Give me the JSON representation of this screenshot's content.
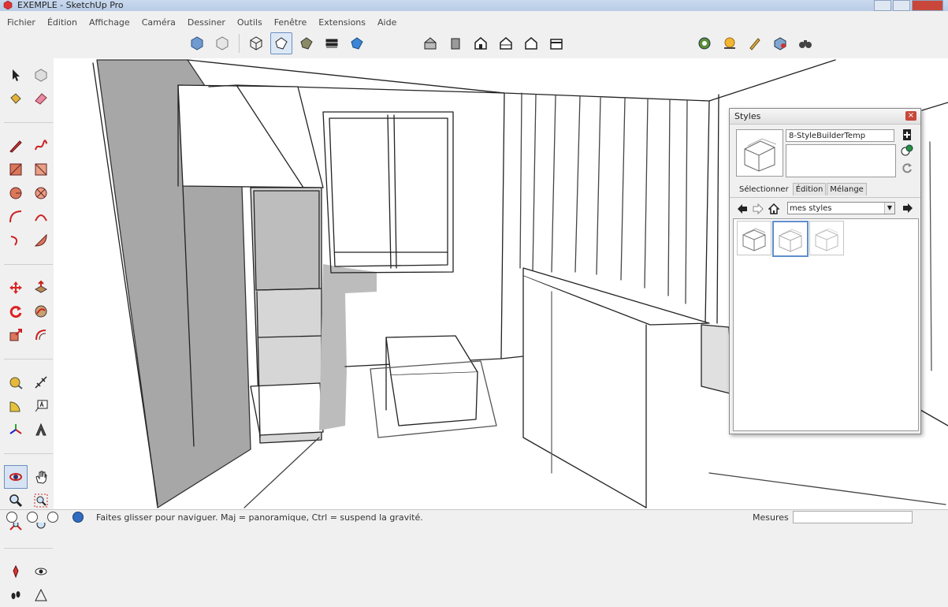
{
  "window": {
    "title": "EXEMPLE - SketchUp Pro"
  },
  "menu": [
    "Fichier",
    "Édition",
    "Affichage",
    "Caméra",
    "Dessiner",
    "Outils",
    "Fenêtre",
    "Extensions",
    "Aide"
  ],
  "toolbar": {
    "views": [
      "iso-view-icon",
      "top-view-icon"
    ],
    "face_styles": [
      "xray-icon",
      "wireframe-icon",
      "hidden-line-icon",
      "shaded-icon",
      "shaded-texture-icon",
      "monochrome-icon"
    ],
    "standard_views": [
      "iso-house-icon",
      "front-house-icon",
      "right-house-icon",
      "back-house-icon",
      "left-house-icon",
      "bottom-house-icon"
    ],
    "extras": [
      "warehouse-icon",
      "sun-shadow-icon",
      "paint-icon",
      "extension-icon",
      "binoculars-icon"
    ]
  },
  "left_tools": [
    "select-icon",
    "component-icon",
    "paint-bucket-icon",
    "eraser-icon",
    "pencil-icon",
    "freehand-icon",
    "rectangle-icon",
    "rotated-rectangle-icon",
    "circle-icon",
    "polygon-icon",
    "arc-icon",
    "two-point-arc-icon",
    "three-point-arc-icon",
    "pie-icon",
    "move-icon",
    "push-pull-icon",
    "rotate-icon",
    "follow-me-icon",
    "scale-icon",
    "offset-icon",
    "tape-measure-icon",
    "dimension-icon",
    "protractor-icon",
    "text-icon",
    "axes-icon",
    "3d-text-icon",
    "orbit-icon",
    "pan-icon",
    "zoom-icon",
    "zoom-window-icon",
    "zoom-extents-icon",
    "previous-view-icon",
    "position-camera-icon",
    "look-around-icon",
    "walk-icon",
    "section-plane-icon"
  ],
  "status": {
    "hint": "Faites glisser pour naviguer. Maj = panoramique, Ctrl = suspend la gravité.",
    "measure_label": "Mesures",
    "measure_value": ""
  },
  "styles_panel": {
    "title": "Styles",
    "close_glyph": "×",
    "style_name": "8-StyleBuilderTemp",
    "tabs": [
      "Sélectionner",
      "Édition",
      "Mélange"
    ],
    "selected_tab": "Sélectionner",
    "collection": "mes styles",
    "thumbnails": 3,
    "selected_thumbnail": 2
  }
}
